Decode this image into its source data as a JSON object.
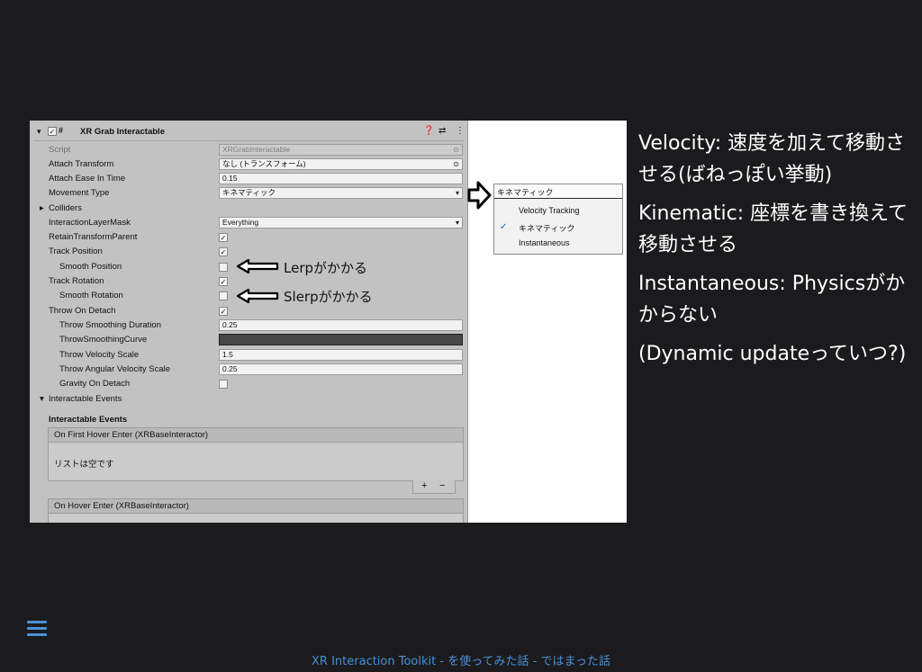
{
  "inspector": {
    "component_title": "XR Grab Interactable",
    "rows": [
      {
        "label": "Script",
        "value": "XRGrabInteractable",
        "icon": "object-picker-icon",
        "disabled": true
      },
      {
        "label": "Attach Transform",
        "value": "なし (トランスフォーム)",
        "icon": "object-picker-icon"
      },
      {
        "label": "Attach Ease In Time",
        "value": "0.15"
      },
      {
        "label": "Movement Type",
        "value": "キネマティック",
        "icon": "dropdown-arrow-icon"
      },
      {
        "label": "Colliders"
      },
      {
        "label": "InteractionLayerMask",
        "value": "Everything",
        "icon": "dropdown-arrow-icon"
      },
      {
        "label": "RetainTransformParent",
        "checked": true
      },
      {
        "label": "Track Position",
        "checked": true
      },
      {
        "label": "Smooth Position",
        "checked": false
      },
      {
        "label": "Track Rotation",
        "checked": true
      },
      {
        "label": "Smooth Rotation",
        "checked": false
      },
      {
        "label": "Throw On Detach",
        "checked": true
      },
      {
        "label": "Throw Smoothing Duration",
        "value": "0.25"
      },
      {
        "label": "ThrowSmoothingCurve"
      },
      {
        "label": "Throw Velocity Scale",
        "value": "1.5"
      },
      {
        "label": "Throw Angular Velocity Scale",
        "value": "0.25"
      },
      {
        "label": "Gravity On Detach",
        "checked": false
      },
      {
        "label": "Interactable Events"
      }
    ],
    "events_heading": "Interactable Events",
    "event1_title": "On First Hover Enter (XRBaseInteractor)",
    "event1_empty": "リストは空です",
    "event2_title": "On Hover Enter (XRBaseInteractor)",
    "plus": "+",
    "minus": "−",
    "check_mark": "✓"
  },
  "annotations": {
    "lerp": "Lerpがかかる",
    "slerp": "Slerpがかかる"
  },
  "dropdown": {
    "selected": "キネマティック",
    "options": [
      "Velocity Tracking",
      "キネマティック",
      "Instantaneous"
    ],
    "checked_option": "キネマティック"
  },
  "notes": {
    "velocity": "Velocity: 速度を加えて移動させる(ばねっぽい挙動)",
    "kinematic": "Kinematic: 座標を書き換えて移動させる",
    "instantaneous": "Instantaneous: Physicsがかからない",
    "dynamic": "(Dynamic updateっていつ?)"
  },
  "footer": "XR Interaction Toolkit - を使ってみた話 - ではまった話",
  "colors": {
    "background": "#1b1b1d",
    "accent": "#4a90d9",
    "inspector_bg": "#c2c2c2"
  }
}
